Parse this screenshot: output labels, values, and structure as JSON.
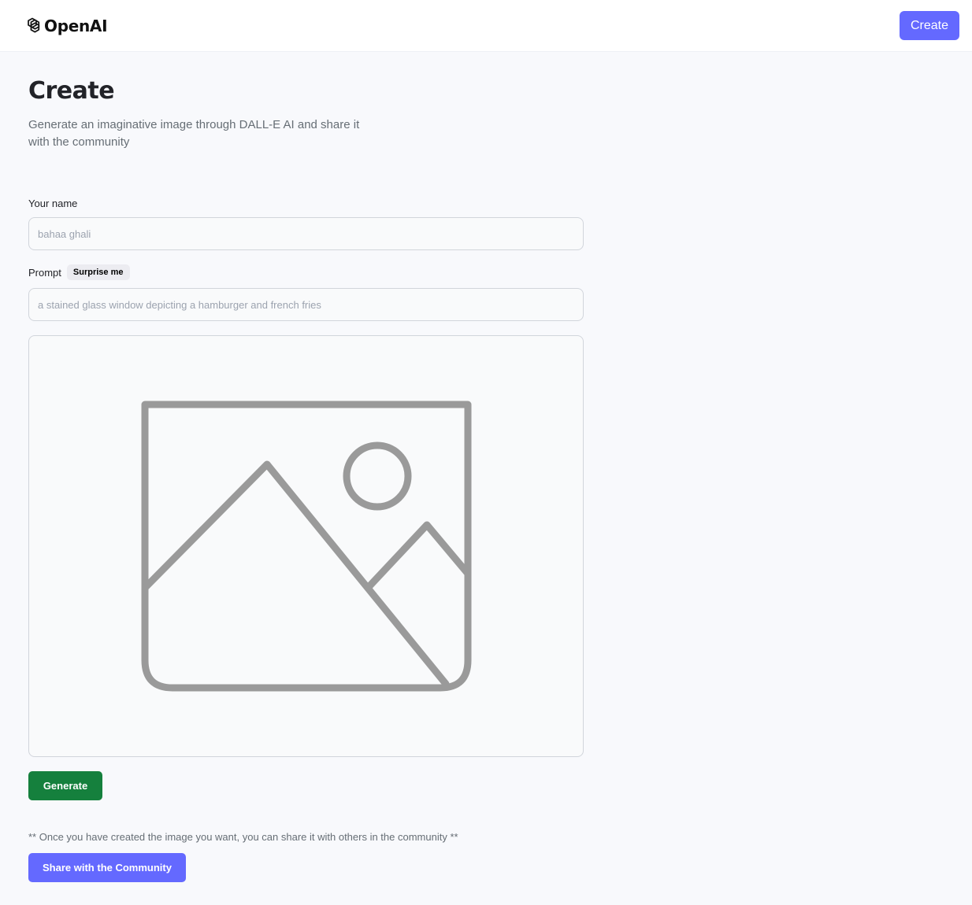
{
  "header": {
    "logo_text": "OpenAI",
    "logo_icon": "openai-logo-icon",
    "create_label": "Create"
  },
  "page": {
    "title": "Create",
    "description": "Generate an imaginative image through DALL-E AI and share it with the community"
  },
  "form": {
    "name_label": "Your name",
    "name_placeholder": "bahaa ghali",
    "prompt_label": "Prompt",
    "surprise_label": "Surprise me",
    "prompt_placeholder": "a stained glass window depicting a hamburger and french fries",
    "preview_icon": "image-placeholder-icon",
    "generate_label": "Generate"
  },
  "share": {
    "note": "** Once you have created the image you want, you can share it with others in the community **",
    "button_label": "Share with the Community"
  },
  "colors": {
    "primary": "#6469ff",
    "generate": "#15803d",
    "background": "#f8f9fc"
  }
}
